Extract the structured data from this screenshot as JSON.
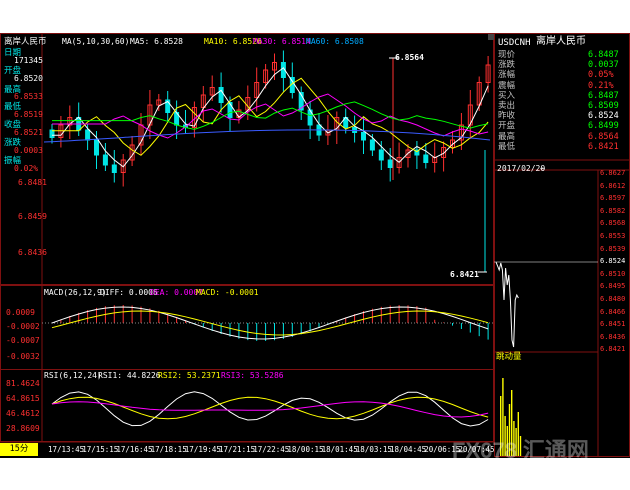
{
  "title_bar": {
    "symbol_name": "离岸人民币",
    "ma_params": "MA(5,10,30,60)",
    "ma5": "MA5: 6.8528",
    "ma10": "MA10: 6.8526",
    "ma30": "MA30: 6.8514",
    "ma60": "MA60: 6.8508"
  },
  "left_info": {
    "date_label": "日期",
    "date_value": "171345",
    "open_label": "开盘",
    "open_value": "6.8520",
    "high_label": "最高",
    "high_value": "6.8533",
    "low_label": "最低",
    "low_value": "6.8519",
    "close_label": "收盘",
    "close_value": "6.8521",
    "change_label": "涨跌",
    "change_value": "0.0003",
    "amp_label": "振幅",
    "amp_value": "0.02%"
  },
  "main_axis": [
    "6.8481",
    "6.8459",
    "6.8436"
  ],
  "annotations": {
    "high_mark": "6.8564",
    "low_mark": "6.8421"
  },
  "macd": {
    "params": "MACD(26,12,9)",
    "diff": "DIFF: 0.0006",
    "dea": "DEA: 0.0007",
    "macd": "MACD: -0.0001",
    "axis": [
      "0.0009",
      "-0.0002",
      "-0.0007",
      "-0.0032"
    ]
  },
  "rsi": {
    "params": "RSI(6,12,24)",
    "rsi1": "RSI1: 44.8226",
    "rsi2": "RSI2: 53.2371",
    "rsi3": "RSI3: 53.5286",
    "axis": [
      "81.4624",
      "64.8615",
      "46.4612",
      "28.8609"
    ]
  },
  "time_axis": {
    "period": "15分",
    "labels": [
      "17/13:45",
      "17/15:15",
      "17/16:45",
      "17/18:15",
      "17/19:45",
      "17/21:15",
      "17/22:45",
      "18/00:15",
      "18/01:45",
      "18/03:15",
      "18/04:45",
      "20/06:15",
      "20/07:45"
    ]
  },
  "quote": {
    "code": "USDCNH",
    "name": "离岸人民币",
    "rows": [
      {
        "label": "现价",
        "value": "6.8487"
      },
      {
        "label": "涨跌",
        "value": "0.0037"
      },
      {
        "label": "涨幅",
        "value": "0.05%"
      },
      {
        "label": "震幅",
        "value": "0.21%"
      },
      {
        "label": "买入",
        "value": "6.8487"
      },
      {
        "label": "卖出",
        "value": "6.8509"
      },
      {
        "label": "昨收",
        "value": "6.8524"
      },
      {
        "label": "开盘",
        "value": "6.8499"
      },
      {
        "label": "最高",
        "value": "6.8564"
      },
      {
        "label": "最低",
        "value": "6.8421"
      }
    ]
  },
  "intraday": {
    "date": "2017/02/20",
    "dash": "—",
    "axis": [
      "6.8627",
      "6.8612",
      "6.8597",
      "6.8582",
      "6.8568",
      "6.8553",
      "6.8539",
      "6.8524",
      "6.8510",
      "6.8495",
      "6.8480",
      "6.8466",
      "6.8451",
      "6.8436",
      "6.8421"
    ],
    "volume_label": "跳动量"
  },
  "watermark": "FX678 汇通网",
  "colors": {
    "up": "#ff3030",
    "down": "#00e6e6",
    "ma5": "#ffffff",
    "ma10": "#ffff00",
    "ma30": "#ff00ff",
    "ma60": "#00ff00"
  }
}
